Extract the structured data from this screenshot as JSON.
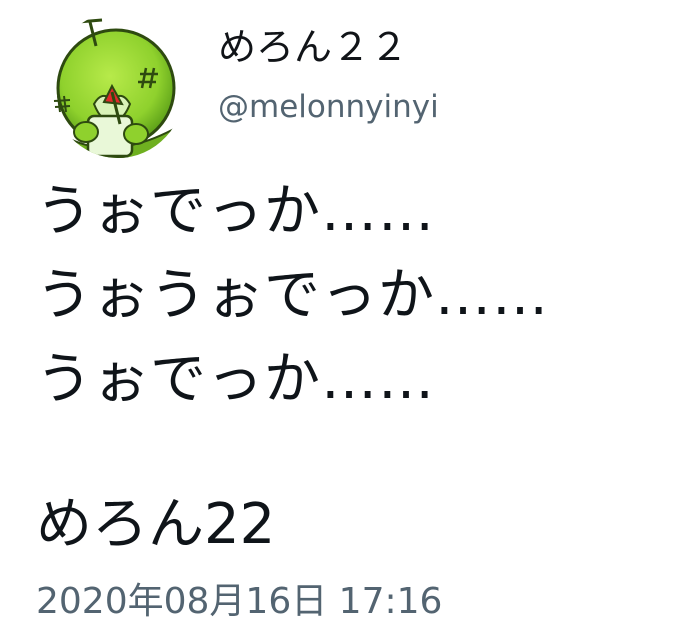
{
  "author": {
    "display_name": "めろん２２",
    "handle": "@melonnyinyi",
    "avatar_icon": "melon-character-avatar-icon"
  },
  "tweet": {
    "lines": [
      "うぉでっか……",
      "うぉうぉでっか……",
      "うぉでっか……"
    ],
    "signature": "めろん22",
    "timestamp": "2020年08月16日 17:16"
  },
  "colors": {
    "text_primary": "#0f1419",
    "text_secondary": "#536471",
    "avatar_green": "#8fd12d",
    "background": "#ffffff"
  }
}
